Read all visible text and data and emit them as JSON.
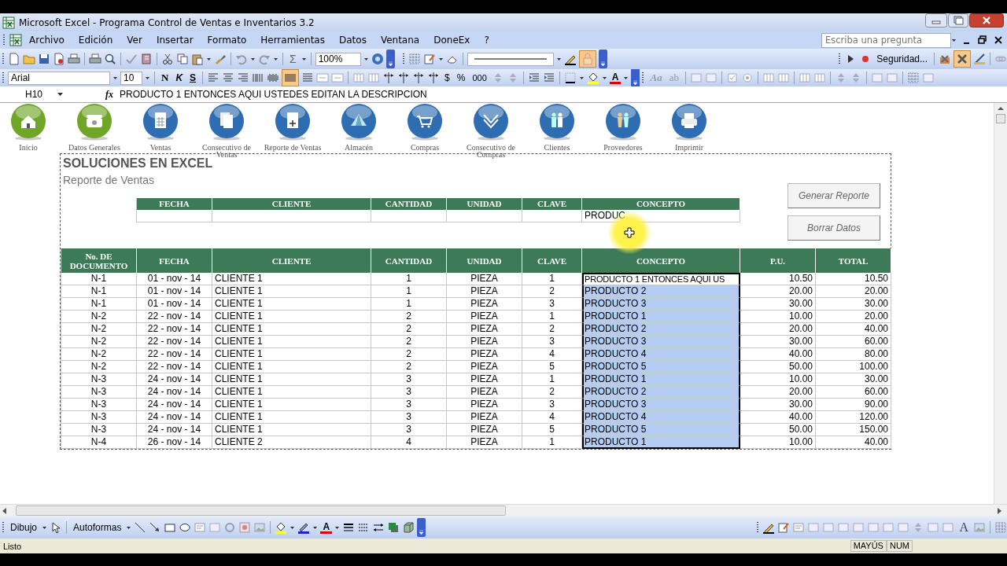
{
  "window": {
    "title": "Microsoft Excel - Programa Control de Ventas e Inventarios 3.2"
  },
  "menu": [
    {
      "label": "Archivo"
    },
    {
      "label": "Edición"
    },
    {
      "label": "Ver"
    },
    {
      "label": "Insertar"
    },
    {
      "label": "Formato"
    },
    {
      "label": "Herramientas"
    },
    {
      "label": "Datos"
    },
    {
      "label": "Ventana"
    },
    {
      "label": "DoneEx"
    },
    {
      "label": "?"
    }
  ],
  "help_box": {
    "placeholder": "Escriba una pregunta"
  },
  "standard_toolbar": {
    "autosum": "Σ",
    "zoom": "100%"
  },
  "border_toolbar": {
    "lock_on": true
  },
  "control_toolbar": {
    "security": "Seguridad...",
    "design_mode_on": true
  },
  "format_toolbar": {
    "font": "Arial",
    "size": "10",
    "bold": "N",
    "italic": "K",
    "underline": "S",
    "distributed_on": true,
    "currency": "$",
    "percent": "%",
    "thousands": "000",
    "font_color": "A"
  },
  "forms_toolbar": {
    "label_tool": "Aa",
    "field_tool": "ab"
  },
  "formula_bar": {
    "cell": "H10",
    "fx": "fx",
    "content": "PRODUCTO 1 ENTONCES AQUI USTEDES EDITAN LA DESCRIPCION"
  },
  "nav_buttons": [
    {
      "label": "Inicio",
      "color": "#6fa628"
    },
    {
      "label": "Datos Generales",
      "color": "#6fa628"
    },
    {
      "label": "Ventas",
      "color": "#2f6db3"
    },
    {
      "label": "Consecutivo de Ventas",
      "color": "#2f6db3"
    },
    {
      "label": "Reporte de Ventas",
      "color": "#2f6db3"
    },
    {
      "label": "Almacén",
      "color": "#2f6db3"
    },
    {
      "label": "Compras",
      "color": "#2f6db3"
    },
    {
      "label": "Consecutivo de Compras",
      "color": "#2f6db3"
    },
    {
      "label": "Clientes",
      "color": "#2f6db3"
    },
    {
      "label": "Proveedores",
      "color": "#2f6db3"
    },
    {
      "label": "Imprimir",
      "color": "#2f6db3"
    }
  ],
  "report": {
    "title": "SOLUCIONES EN EXCEL",
    "subtitle": "Reporte de Ventas",
    "filter_columns": [
      "FECHA",
      "CLIENTE",
      "CANTIDAD",
      "UNIDAD",
      "CLAVE",
      "CONCEPTO"
    ],
    "concept_filter": "PRODUC",
    "buttons": [
      "Generar Reporte",
      "Borrar Datos"
    ]
  },
  "table": {
    "columns": [
      "No. DE DOCUMENTO",
      "FECHA",
      "CLIENTE",
      "CANTIDAD",
      "UNIDAD",
      "CLAVE",
      "CONCEPTO",
      "P.U.",
      "TOTAL"
    ],
    "rows": [
      {
        "document": "N-1",
        "date": "01 - nov - 14",
        "client": "CLIENTE 1",
        "quantity": "1",
        "unit": "PIEZA",
        "key": "1",
        "concept": "PRODUCTO 1 ENTONCES AQUI US",
        "price": "10.50",
        "total": "10.50",
        "active": true,
        "selected": true
      },
      {
        "document": "N-1",
        "date": "01 - nov - 14",
        "client": "CLIENTE 1",
        "quantity": "1",
        "unit": "PIEZA",
        "key": "2",
        "concept": "PRODUCTO 2",
        "price": "20.00",
        "total": "20.00",
        "active": false,
        "selected": true
      },
      {
        "document": "N-1",
        "date": "01 - nov - 14",
        "client": "CLIENTE 1",
        "quantity": "1",
        "unit": "PIEZA",
        "key": "3",
        "concept": "PRODUCTO 3",
        "price": "30.00",
        "total": "30.00",
        "active": false,
        "selected": true
      },
      {
        "document": "N-2",
        "date": "22 - nov - 14",
        "client": "CLIENTE 1",
        "quantity": "2",
        "unit": "PIEZA",
        "key": "1",
        "concept": "PRODUCTO 1",
        "price": "10.00",
        "total": "20.00",
        "active": false,
        "selected": true
      },
      {
        "document": "N-2",
        "date": "22 - nov - 14",
        "client": "CLIENTE 1",
        "quantity": "2",
        "unit": "PIEZA",
        "key": "2",
        "concept": "PRODUCTO 2",
        "price": "20.00",
        "total": "40.00",
        "active": false,
        "selected": true
      },
      {
        "document": "N-2",
        "date": "22 - nov - 14",
        "client": "CLIENTE 1",
        "quantity": "2",
        "unit": "PIEZA",
        "key": "3",
        "concept": "PRODUCTO 3",
        "price": "30.00",
        "total": "60.00",
        "active": false,
        "selected": true
      },
      {
        "document": "N-2",
        "date": "22 - nov - 14",
        "client": "CLIENTE 1",
        "quantity": "2",
        "unit": "PIEZA",
        "key": "4",
        "concept": "PRODUCTO 4",
        "price": "40.00",
        "total": "80.00",
        "active": false,
        "selected": true
      },
      {
        "document": "N-2",
        "date": "22 - nov - 14",
        "client": "CLIENTE 1",
        "quantity": "2",
        "unit": "PIEZA",
        "key": "5",
        "concept": "PRODUCTO 5",
        "price": "50.00",
        "total": "100.00",
        "active": false,
        "selected": true
      },
      {
        "document": "N-3",
        "date": "24 - nov - 14",
        "client": "CLIENTE 1",
        "quantity": "3",
        "unit": "PIEZA",
        "key": "1",
        "concept": "PRODUCTO 1",
        "price": "10.00",
        "total": "30.00",
        "active": false,
        "selected": true
      },
      {
        "document": "N-3",
        "date": "24 - nov - 14",
        "client": "CLIENTE 1",
        "quantity": "3",
        "unit": "PIEZA",
        "key": "2",
        "concept": "PRODUCTO 2",
        "price": "20.00",
        "total": "60.00",
        "active": false,
        "selected": true
      },
      {
        "document": "N-3",
        "date": "24 - nov - 14",
        "client": "CLIENTE 1",
        "quantity": "3",
        "unit": "PIEZA",
        "key": "3",
        "concept": "PRODUCTO 3",
        "price": "30.00",
        "total": "90.00",
        "active": false,
        "selected": true
      },
      {
        "document": "N-3",
        "date": "24 - nov - 14",
        "client": "CLIENTE 1",
        "quantity": "3",
        "unit": "PIEZA",
        "key": "4",
        "concept": "PRODUCTO 4",
        "price": "40.00",
        "total": "120.00",
        "active": false,
        "selected": true
      },
      {
        "document": "N-3",
        "date": "24 - nov - 14",
        "client": "CLIENTE 1",
        "quantity": "3",
        "unit": "PIEZA",
        "key": "5",
        "concept": "PRODUCTO 5",
        "price": "50.00",
        "total": "150.00",
        "active": false,
        "selected": true
      },
      {
        "document": "N-4",
        "date": "26 - nov - 14",
        "client": "CLIENTE 2",
        "quantity": "4",
        "unit": "PIEZA",
        "key": "1",
        "concept": "PRODUCTO 1",
        "price": "10.00",
        "total": "40.00",
        "active": false,
        "selected": true
      }
    ]
  },
  "drawing_toolbar": {
    "draw": "Dibujo",
    "autoshapes": "Autoformas",
    "font_color": "A",
    "wordart_letter": "A"
  },
  "status_bar": {
    "text": "Listo",
    "caps": "MAYÚS",
    "num": "NUM"
  }
}
